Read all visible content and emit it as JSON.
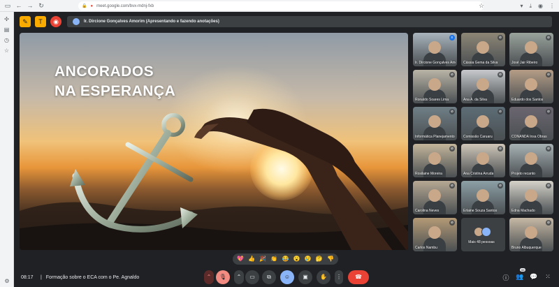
{
  "browser": {
    "url": "meet.google.com/bvx-mdnj-fxb",
    "back_icon": "arrow-left-icon",
    "forward_icon": "arrow-right-icon",
    "reload_icon": "reload-icon"
  },
  "top_actions": {
    "presenting_label": "Ir. Dircione Gonçalves Amorim (Apresentando e fazendo anotações)"
  },
  "slide": {
    "title_line1": "ANCORADOS",
    "title_line2": "NA ESPERANÇA"
  },
  "participants": [
    {
      "name": "Ir. Dircione Gonçalves Amorim",
      "mic": "speaking",
      "shade": "#a9b4bd"
    },
    {
      "name": "Cássia Gema da Silva",
      "mic": "muted",
      "shade": "#8d8676"
    },
    {
      "name": "José Jair Ribeiro",
      "mic": "muted",
      "shade": "#9aa39c"
    },
    {
      "name": "Ronaldo Soares Lima",
      "mic": "muted",
      "shade": "#b9b4a6"
    },
    {
      "name": "Ana A. da Silva",
      "mic": "muted",
      "shade": "#c7c9cc"
    },
    {
      "name": "Eduardo dos Santos",
      "mic": "muted",
      "shade": "#b59d86"
    },
    {
      "name": "Informática Planejamento",
      "mic": "muted",
      "shade": "#6f7f86"
    },
    {
      "name": "Comissão Caruaru",
      "mic": "muted",
      "shade": "#5d6d76"
    },
    {
      "name": "CONANDA Insa Obras",
      "mic": "muted",
      "shade": "#6b6670"
    },
    {
      "name": "Rosilaine Moreira",
      "mic": "muted",
      "shade": "#c3b59b"
    },
    {
      "name": "Ana Cristina Arruda",
      "mic": "muted",
      "shade": "#cfc6b8"
    },
    {
      "name": "Projeto recanto",
      "mic": "muted",
      "shade": "#a7b1b3"
    },
    {
      "name": "Carolina Neves",
      "mic": "muted",
      "shade": "#b6a893"
    },
    {
      "name": "Erlaine Souza Santos",
      "mic": "muted",
      "shade": "#8ca0a6"
    },
    {
      "name": "Edna Machado",
      "mic": "muted",
      "shade": "#d5d2c9"
    },
    {
      "name": "Carlos Nambu",
      "mic": "muted",
      "shade": "#b49a76"
    },
    {
      "name": "Mais 48 pessoas",
      "mic": "none",
      "shade": "#3c4043"
    },
    {
      "name": "Bruno Albuquerque",
      "mic": "muted",
      "shade": "#c6b8a4"
    }
  ],
  "reactions": [
    "💖",
    "👍",
    "🎉",
    "👏",
    "😂",
    "😮",
    "😢",
    "🤔",
    "👎"
  ],
  "bottom_bar": {
    "time": "08:17",
    "separator": "|",
    "meeting_title": "Formação sobre o ECA com o Pe. Agnaldo",
    "participant_count": "66"
  }
}
